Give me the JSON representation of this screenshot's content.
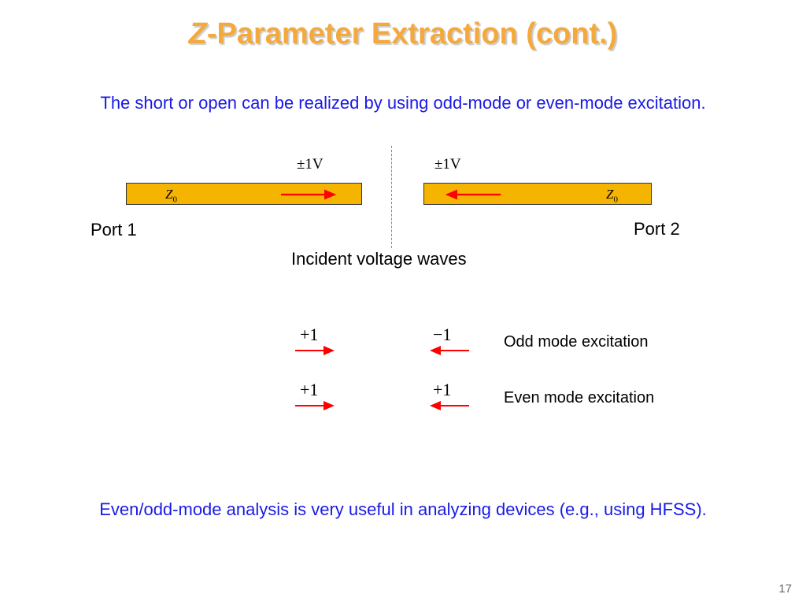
{
  "title": {
    "prefix_italic": "Z",
    "rest": "-Parameter Extraction (cont.)"
  },
  "subtitle": "The short or open can be realized by using odd-mode or even-mode excitation.",
  "diagram": {
    "z_label_left": "Z",
    "z_sub_left": "0",
    "z_label_right": "Z",
    "z_sub_right": "0",
    "v_label_left": "±1V",
    "v_label_right": "±1V",
    "port1": "Port 1",
    "port2": "Port 2",
    "caption": "Incident voltage waves"
  },
  "modes": {
    "odd": {
      "left": "+1",
      "right": "−1",
      "label": "Odd mode excitation"
    },
    "even": {
      "left": "+1",
      "right": "+1",
      "label": "Even mode excitation"
    }
  },
  "footnote": "Even/odd-mode analysis is very useful in analyzing devices (e.g., using HFSS).",
  "page": "17",
  "colors": {
    "accent": "#f4a93c",
    "link": "#1a1ae6",
    "bar": "#f4b400",
    "arrow": "#ff0000"
  }
}
